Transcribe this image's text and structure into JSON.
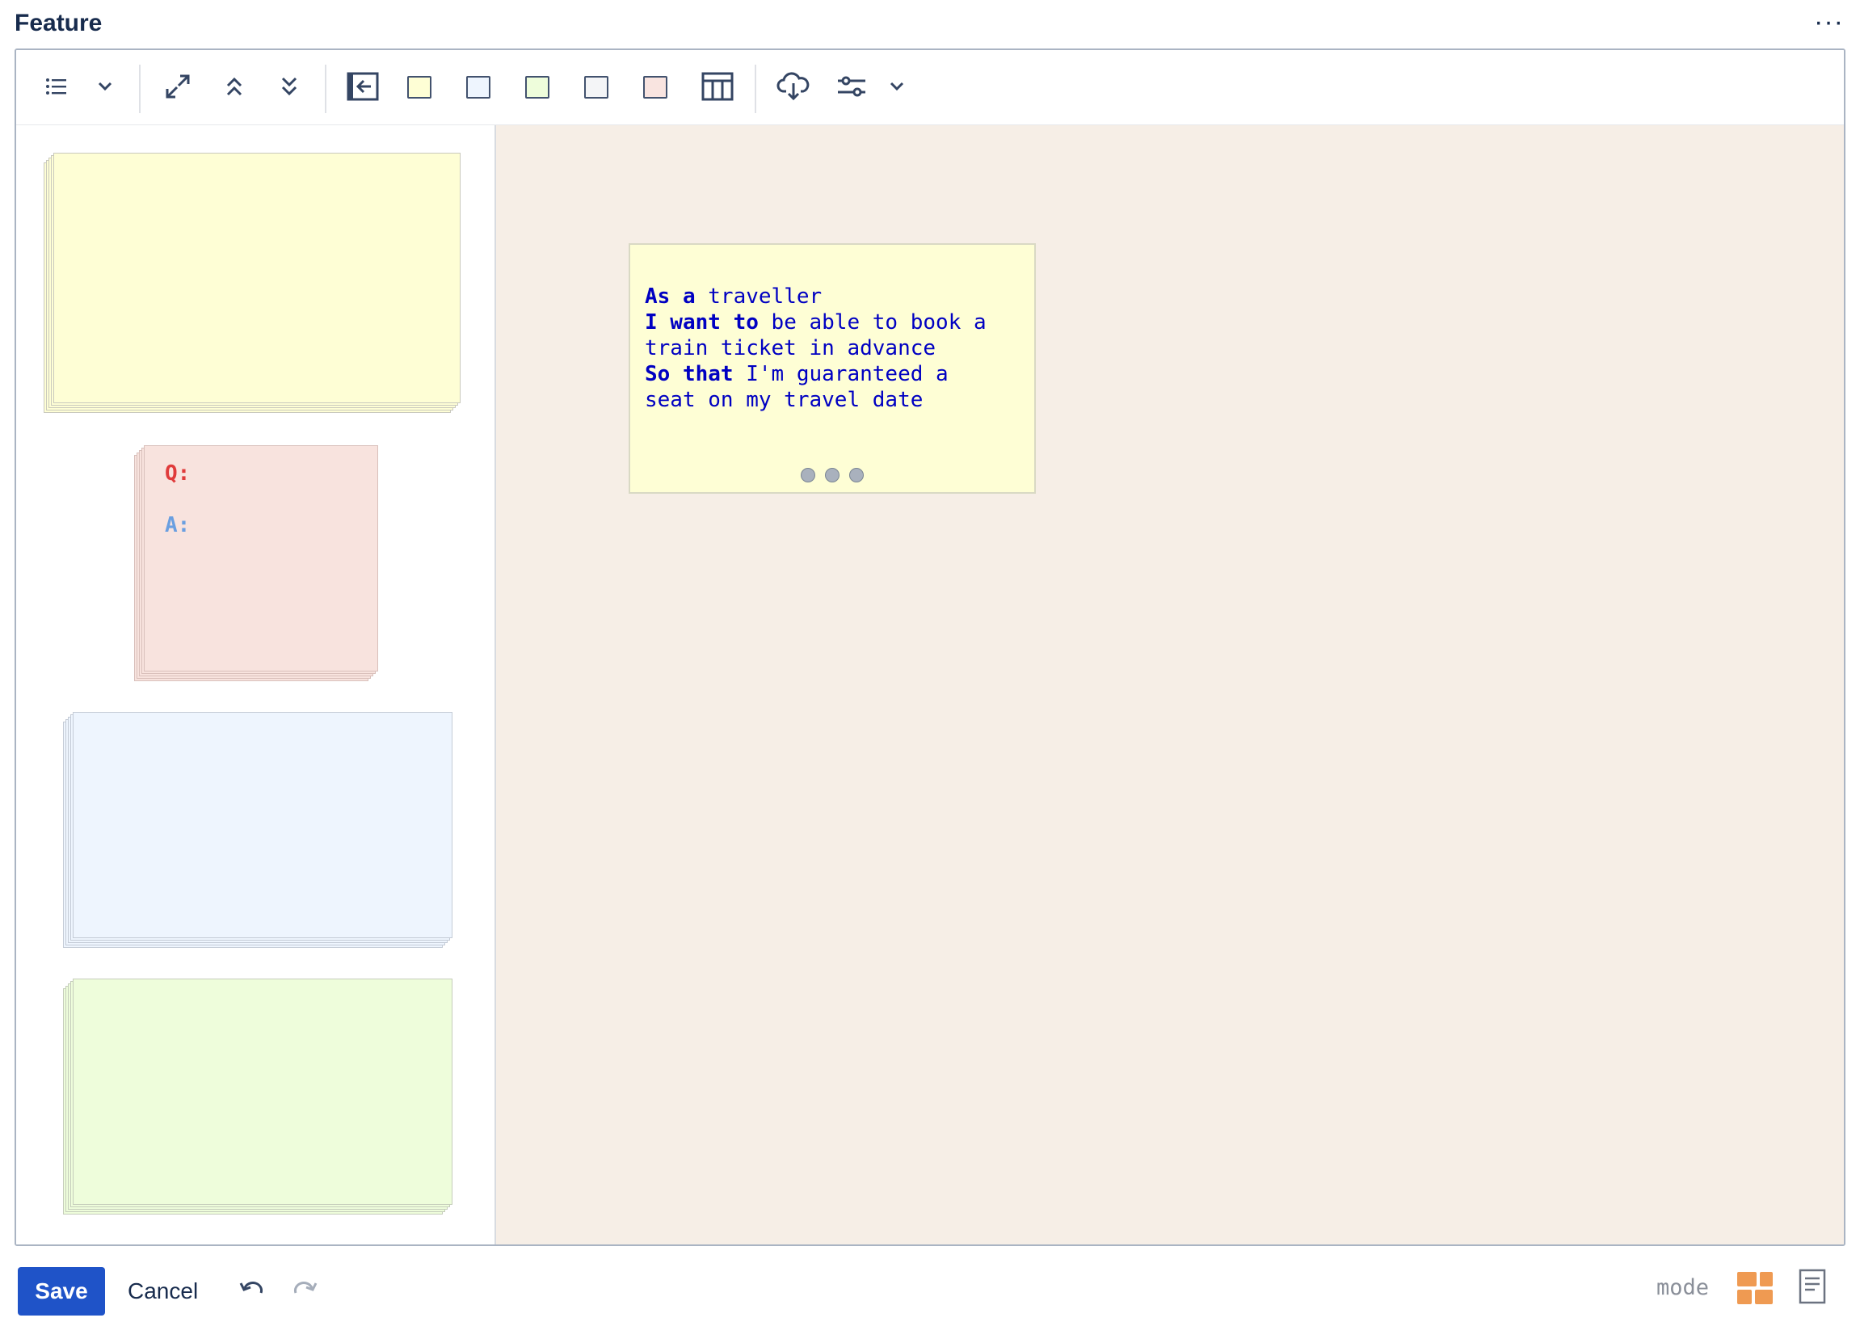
{
  "header": {
    "title": "Feature",
    "more_label": "···"
  },
  "toolbar": {
    "items": [
      "list-icon",
      "chevron-down-icon",
      "expand-icon",
      "collapse-up-icon",
      "collapse-down-icon",
      "back-to-palette-icon",
      "swatch-yellow",
      "swatch-blue",
      "swatch-green",
      "swatch-gray",
      "swatch-pink",
      "table-icon",
      "cloud-download-icon",
      "settings-sliders-icon",
      "chevron-down-icon"
    ],
    "swatch_colors": {
      "yellow": "#fefed5",
      "blue": "#eef5fe",
      "green": "#eefddb",
      "gray": "#f4f5f7",
      "pink": "#f9e4e0"
    }
  },
  "palette": {
    "qa_card": {
      "q_label": "Q:",
      "a_label": "A:",
      "q_color": "#e03b3b",
      "a_color": "#6a9fe0"
    },
    "card_colors": {
      "yellow": "#fefed5",
      "pink": "#f8e3de",
      "blue": "#eef5fe",
      "green": "#eefddb"
    }
  },
  "board": {
    "background": "#f6eee6",
    "story_card": {
      "line1_kw": "As a",
      "line1_text": " traveller",
      "line2_kw": "I want to",
      "line2_text": " be able to book a",
      "line3_text": "train ticket in advance",
      "line4_kw": "So that",
      "line4_text": " I'm guaranteed a",
      "line5_text": "seat on my travel date"
    }
  },
  "footer": {
    "save_label": "Save",
    "cancel_label": "Cancel",
    "mode_label": "mode",
    "accent": "#1f53c8",
    "mode_icon_color": "#ef9a52"
  }
}
